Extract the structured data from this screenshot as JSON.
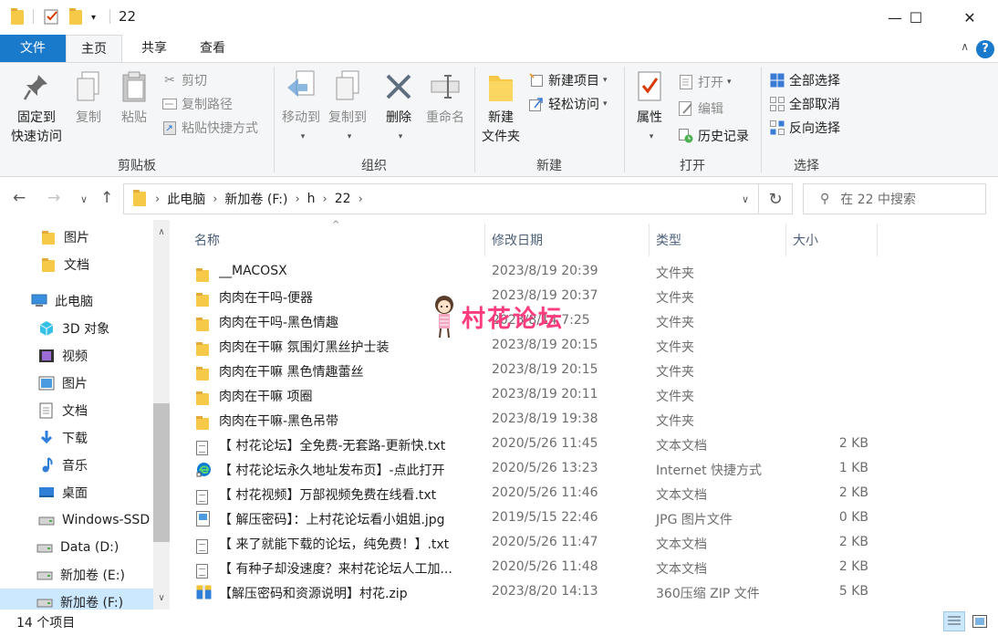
{
  "window": {
    "title": "22",
    "minimize": "—",
    "maximize": "☐",
    "close": "✕"
  },
  "tabs": [
    {
      "label": "文件"
    },
    {
      "label": "主页"
    },
    {
      "label": "共享"
    },
    {
      "label": "查看"
    }
  ],
  "ribbon": {
    "clipboard": {
      "title": "剪贴板",
      "pin_line1": "固定到",
      "pin_line2": "快速访问",
      "copy": "复制",
      "paste": "粘贴",
      "cut": "剪切",
      "copy_path": "复制路径",
      "paste_shortcut": "粘贴快捷方式"
    },
    "organize": {
      "title": "组织",
      "move_to": "移动到",
      "copy_to": "复制到",
      "delete": "删除",
      "rename": "重命名"
    },
    "new": {
      "title": "新建",
      "new_folder_line1": "新建",
      "new_folder_line2": "文件夹",
      "new_item": "新建项目",
      "easy_access": "轻松访问"
    },
    "open": {
      "title": "打开",
      "properties": "属性",
      "open": "打开",
      "edit": "编辑",
      "history": "历史记录"
    },
    "select": {
      "title": "选择",
      "select_all": "全部选择",
      "select_none": "全部取消",
      "invert": "反向选择"
    }
  },
  "address": {
    "crumbs": [
      "此电脑",
      "新加卷 (F:)",
      "h",
      "22"
    ],
    "search_placeholder": "在 22 中搜索"
  },
  "sidebar": {
    "items": [
      {
        "label": "图片",
        "icon": "folder-icon"
      },
      {
        "label": "文档",
        "icon": "folder-icon"
      },
      {
        "label": "此电脑",
        "icon": "computer-icon"
      },
      {
        "label": "3D 对象",
        "icon": "cube-icon"
      },
      {
        "label": "视频",
        "icon": "film-icon"
      },
      {
        "label": "图片",
        "icon": "picture-icon"
      },
      {
        "label": "文档",
        "icon": "document-icon"
      },
      {
        "label": "下载",
        "icon": "download-arrow-icon"
      },
      {
        "label": "音乐",
        "icon": "music-note-icon"
      },
      {
        "label": "桌面",
        "icon": "desktop-icon"
      },
      {
        "label": "Windows-SSD",
        "icon": "drive-icon"
      },
      {
        "label": "Data (D:)",
        "icon": "drive-icon"
      },
      {
        "label": "新加卷 (E:)",
        "icon": "drive-icon"
      },
      {
        "label": "新加卷 (F:)",
        "icon": "drive-icon"
      }
    ]
  },
  "columns": {
    "name": "名称",
    "date": "修改日期",
    "type": "类型",
    "size": "大小"
  },
  "files": [
    {
      "name": "__MACOSX",
      "date": "2023/8/19 20:39",
      "type": "文件夹",
      "size": "",
      "icon": "folder-icon"
    },
    {
      "name": "肉肉在干吗-便器",
      "date": "2023/8/19 20:37",
      "type": "文件夹",
      "size": "",
      "icon": "folder-icon"
    },
    {
      "name": "肉肉在干吗-黑色情趣",
      "date": "2023/8/14 7:25",
      "type": "文件夹",
      "size": "",
      "icon": "folder-icon"
    },
    {
      "name": "肉肉在干嘛 氛围灯黑丝护士装",
      "date": "2023/8/19 20:15",
      "type": "文件夹",
      "size": "",
      "icon": "folder-icon"
    },
    {
      "name": "肉肉在干嘛 黑色情趣蕾丝",
      "date": "2023/8/19 20:15",
      "type": "文件夹",
      "size": "",
      "icon": "folder-icon"
    },
    {
      "name": "肉肉在干嘛 项圈",
      "date": "2023/8/19 20:11",
      "type": "文件夹",
      "size": "",
      "icon": "folder-icon"
    },
    {
      "name": "肉肉在干嘛-黑色吊带",
      "date": "2023/8/19 19:38",
      "type": "文件夹",
      "size": "",
      "icon": "folder-icon"
    },
    {
      "name": "【 村花论坛】全免费-无套路-更新快.txt",
      "date": "2020/5/26 11:45",
      "type": "文本文档",
      "size": "2 KB",
      "icon": "text-file-icon"
    },
    {
      "name": "【 村花论坛永久地址发布页】-点此打开",
      "date": "2020/5/26 13:23",
      "type": "Internet 快捷方式",
      "size": "1 KB",
      "icon": "edge-shortcut-icon"
    },
    {
      "name": "【 村花视频】万部视频免费在线看.txt",
      "date": "2020/5/26 11:46",
      "type": "文本文档",
      "size": "2 KB",
      "icon": "text-file-icon"
    },
    {
      "name": "【 解压密码】：上村花论坛看小姐姐.jpg",
      "date": "2019/5/15 22:46",
      "type": "JPG 图片文件",
      "size": "0 KB",
      "icon": "image-file-icon"
    },
    {
      "name": "【 来了就能下载的论坛，纯免费！】.txt",
      "date": "2020/5/26 11:47",
      "type": "文本文档",
      "size": "2 KB",
      "icon": "text-file-icon"
    },
    {
      "name": "【 有种子却没速度？来村花论坛人工加...",
      "date": "2020/5/26 11:48",
      "type": "文本文档",
      "size": "2 KB",
      "icon": "text-file-icon"
    },
    {
      "name": "【解压密码和资源说明】村花.zip",
      "date": "2023/8/20 14:13",
      "type": "360压缩 ZIP 文件",
      "size": "5 KB",
      "icon": "zip-archive-icon"
    }
  ],
  "watermark": "村花论坛",
  "status": {
    "count": "14 个项目"
  },
  "colors": {
    "accent": "#1979ca",
    "folder": "#f7c948",
    "selection": "#cce8ff",
    "watermark": "#ff3b7f"
  }
}
